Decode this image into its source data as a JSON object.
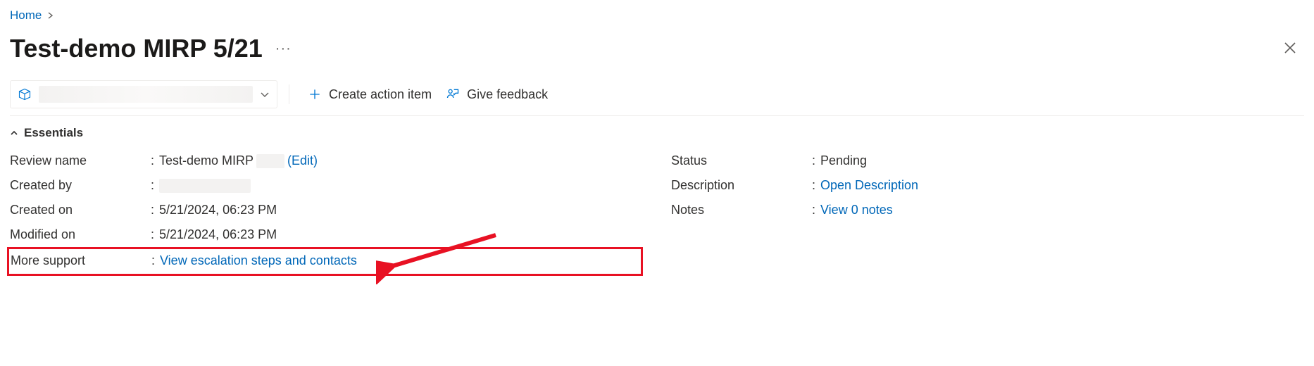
{
  "breadcrumb": {
    "home": "Home"
  },
  "title": "Test-demo MIRP 5/21",
  "toolbar": {
    "create_action": "Create action item",
    "give_feedback": "Give feedback"
  },
  "section": {
    "essentials": "Essentials"
  },
  "left": {
    "review_name_label": "Review name",
    "review_name_value": "Test-demo MIRP",
    "edit_label": "(Edit)",
    "created_by_label": "Created by",
    "created_on_label": "Created on",
    "created_on_value": "5/21/2024, 06:23 PM",
    "modified_on_label": "Modified on",
    "modified_on_value": "5/21/2024, 06:23 PM",
    "more_support_label": "More support",
    "more_support_link": "View escalation steps and contacts"
  },
  "right": {
    "status_label": "Status",
    "status_value": "Pending",
    "description_label": "Description",
    "description_link": "Open Description",
    "notes_label": "Notes",
    "notes_link": "View 0 notes"
  }
}
